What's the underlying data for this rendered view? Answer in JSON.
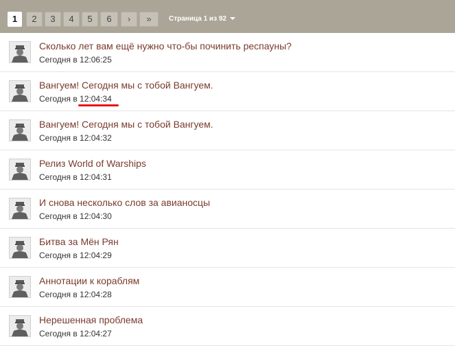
{
  "pagination": {
    "pages": [
      "1",
      "2",
      "3",
      "4",
      "5",
      "6"
    ],
    "current_page": "1",
    "next_label": "›",
    "last_label": "»",
    "page_info": "Страница 1 из 92"
  },
  "topics": [
    {
      "title": "Сколько лет вам ещё нужно что-бы починить респауны?",
      "time": "Сегодня в 12:06:25"
    },
    {
      "title": "Вангуем! Сегодня мы с тобой Вангуем.",
      "time": "Сегодня в 12:04:34"
    },
    {
      "title": "Вангуем! Сегодня мы с тобой Вангуем.",
      "time": "Сегодня в 12:04:32"
    },
    {
      "title": "Релиз World of Warships",
      "time": "Сегодня в 12:04:31"
    },
    {
      "title": "И снова несколько слов за авианосцы",
      "time": "Сегодня в 12:04:30"
    },
    {
      "title": "Битва за Мён Рян",
      "time": "Сегодня в 12:04:29"
    },
    {
      "title": "Аннотации к кораблям",
      "time": "Сегодня в 12:04:28"
    },
    {
      "title": "Нерешенная проблема",
      "time": "Сегодня в 12:04:27"
    }
  ],
  "annotation": {
    "color": "#e8141a"
  }
}
